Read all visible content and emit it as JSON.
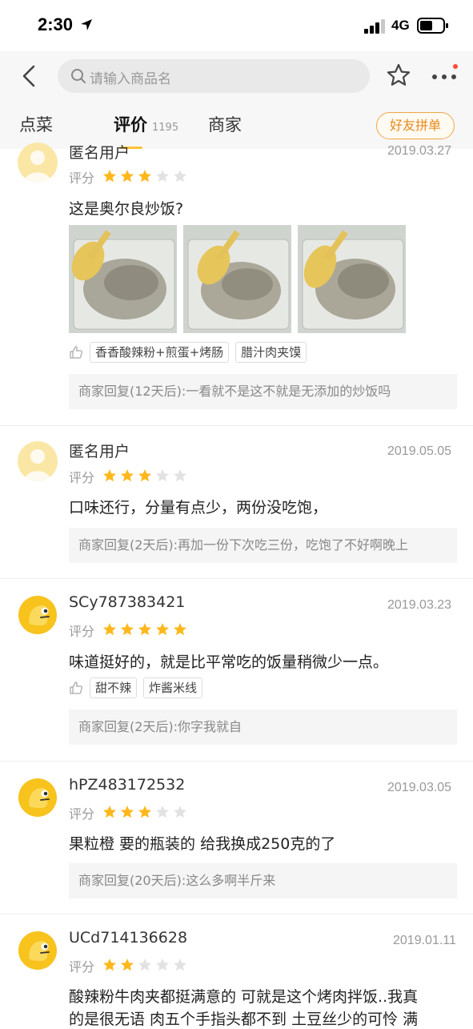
{
  "status_bar": {
    "time": "2:30",
    "network": "4G"
  },
  "header": {
    "search_placeholder": "请输入商品名",
    "tabs": [
      {
        "label": "点菜"
      },
      {
        "label": "评价",
        "count": "1195"
      },
      {
        "label": "商家"
      }
    ],
    "friend_button": "好友拼单"
  },
  "reviews": [
    {
      "user": "匿名用户",
      "date": "2019.03.27",
      "rating_label": "评分",
      "stars": 3,
      "text": "这是奥尔良炒饭?",
      "photos": 3,
      "tags": [
        "香香酸辣粉+煎蛋+烤肠",
        "腊汁肉夹馍"
      ],
      "reply": "商家回复(12天后):一看就不是这不就是无添加的炒饭吗"
    },
    {
      "user": "匿名用户",
      "date": "2019.05.05",
      "rating_label": "评分",
      "stars": 3,
      "text": "口味还行，分量有点少，两份没吃饱，",
      "reply": "商家回复(2天后):再加一份下次吃三份，吃饱了不好啊晚上"
    },
    {
      "user": "SCy787383421",
      "date": "2019.03.23",
      "rating_label": "评分",
      "stars": 5,
      "text": "味道挺好的，就是比平常吃的饭量稍微少一点。",
      "tags": [
        "甜不辣",
        "炸酱米线"
      ],
      "reply": "商家回复(2天后):你字我就自"
    },
    {
      "user": "hPZ483172532",
      "date": "2019.03.05",
      "rating_label": "评分",
      "stars": 3,
      "text": "果粒橙 要的瓶装的 给我换成250克的了",
      "reply": "商家回复(20天后):这么多啊半斤来"
    },
    {
      "user": "UCd714136628",
      "date": "2019.01.11",
      "rating_label": "评分",
      "stars": 2,
      "text": "酸辣粉牛肉夹都挺满意的 可就是这个烤肉拌饭..我真",
      "text2": "的是很无语  肉五个手指头都不到 土豆丝少的可怜 满"
    }
  ],
  "colors": {
    "star_on": "#ffb81c",
    "star_off": "#e2e2e2",
    "accent": "#ffc233",
    "friend": "#e88a1a"
  }
}
